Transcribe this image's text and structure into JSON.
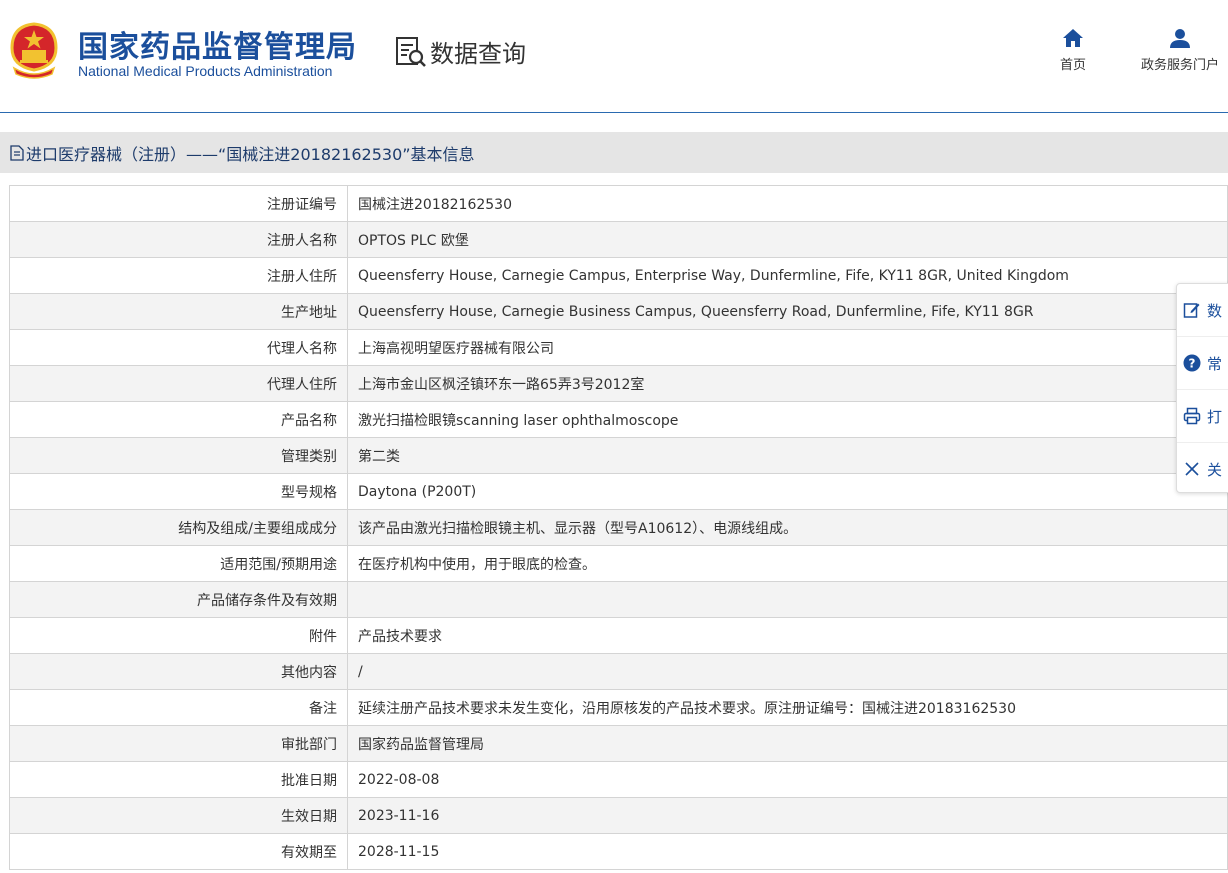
{
  "header": {
    "org_name_cn": "国家药品监督管理局",
    "org_name_en": "National Medical Products Administration",
    "section_title": "数据查询",
    "nav": [
      {
        "label": "首页",
        "icon": "home-icon"
      },
      {
        "label": "政务服务门户",
        "icon": "user-icon"
      }
    ]
  },
  "page_title": "进口医疗器械（注册）——“国械注进20182162530”基本信息",
  "details": [
    {
      "label": "注册证编号",
      "value": "国械注进20182162530"
    },
    {
      "label": "注册人名称",
      "value": "OPTOS PLC 欧堡"
    },
    {
      "label": "注册人住所",
      "value": "Queensferry House, Carnegie Campus, Enterprise Way, Dunfermline, Fife, KY11 8GR, United Kingdom"
    },
    {
      "label": "生产地址",
      "value": "Queensferry House, Carnegie Business Campus, Queensferry Road, Dunfermline, Fife, KY11 8GR"
    },
    {
      "label": "代理人名称",
      "value": "上海高视明望医疗器械有限公司"
    },
    {
      "label": "代理人住所",
      "value": "上海市金山区枫泾镇环东一路65弄3号2012室"
    },
    {
      "label": "产品名称",
      "value": "激光扫描检眼镜scanning laser ophthalmoscope"
    },
    {
      "label": "管理类别",
      "value": "第二类"
    },
    {
      "label": "型号规格",
      "value": "Daytona (P200T)"
    },
    {
      "label": "结构及组成/主要组成成分",
      "value": "该产品由激光扫描检眼镜主机、显示器（型号A10612）、电源线组成。"
    },
    {
      "label": "适用范围/预期用途",
      "value": "在医疗机构中使用，用于眼底的检查。"
    },
    {
      "label": "产品储存条件及有效期",
      "value": ""
    },
    {
      "label": "附件",
      "value": "产品技术要求"
    },
    {
      "label": "其他内容",
      "value": "/"
    },
    {
      "label": "备注",
      "value": "延续注册产品技术要求未发生变化，沿用原核发的产品技术要求。原注册证编号：国械注进20183162530"
    },
    {
      "label": "审批部门",
      "value": "国家药品监督管理局"
    },
    {
      "label": "批准日期",
      "value": "2022-08-08"
    },
    {
      "label": "生效日期",
      "value": "2023-11-16"
    },
    {
      "label": "有效期至",
      "value": "2028-11-15"
    }
  ],
  "float_menu": [
    {
      "label": "数",
      "icon": "edit-icon"
    },
    {
      "label": "常",
      "icon": "help-icon"
    },
    {
      "label": "打",
      "icon": "print-icon"
    },
    {
      "label": "关",
      "icon": "close-icon"
    }
  ],
  "colors": {
    "brand": "#1b4f9c",
    "titlebar": "#e5e5e5",
    "row_alt": "#f3f3f3",
    "emblem_red": "#d4262a",
    "emblem_gold": "#f2c230"
  }
}
